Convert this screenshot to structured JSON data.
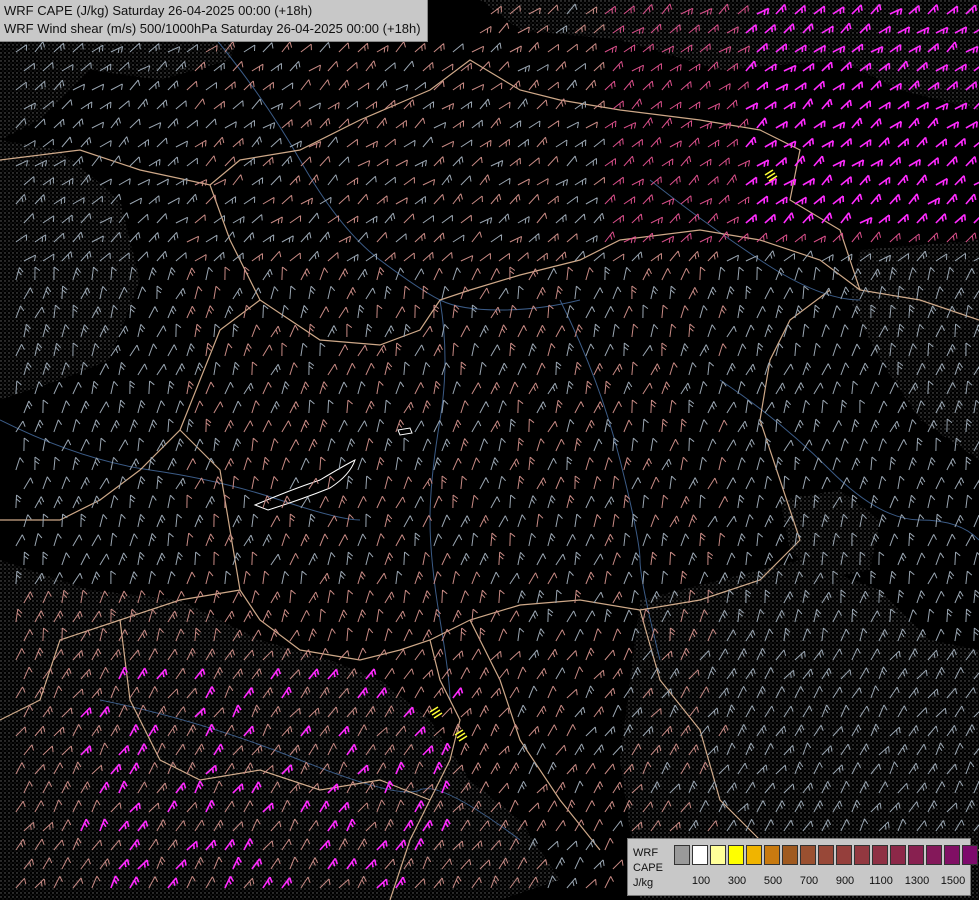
{
  "header": {
    "line1": "WRF CAPE (J/kg) Saturday 26-04-2025 00:00 (+18h)",
    "line2": "WRF Wind shear (m/s) 500/1000hPa Saturday 26-04-2025 00:00 (+18h)"
  },
  "legend": {
    "title_line1": "WRF",
    "title_line2": "CAPE",
    "unit": "J/kg",
    "colors": [
      "#9a9a9a",
      "#ffffff",
      "#ffff99",
      "#ffff00",
      "#f0b400",
      "#c87a10",
      "#a05a20",
      "#9a5030",
      "#984838",
      "#953f3c",
      "#923840",
      "#8f3044",
      "#8c2848",
      "#882050",
      "#84185a",
      "#800f64",
      "#7d0a6c"
    ],
    "tick_labels": [
      "100",
      "300",
      "500",
      "700",
      "900",
      "1100",
      "1300",
      "1500"
    ]
  },
  "palette": {
    "background": "#000000",
    "shear_low": "#9aa6b2",
    "shear_mid": "#c88a84",
    "shear_high": "#d94f8a",
    "shear_extreme": "#ff2bff",
    "cape_yellow": "#ffff33",
    "border": "#f2c6a0",
    "river": "#3b5b86",
    "terrain": "#6e6e6e"
  }
}
